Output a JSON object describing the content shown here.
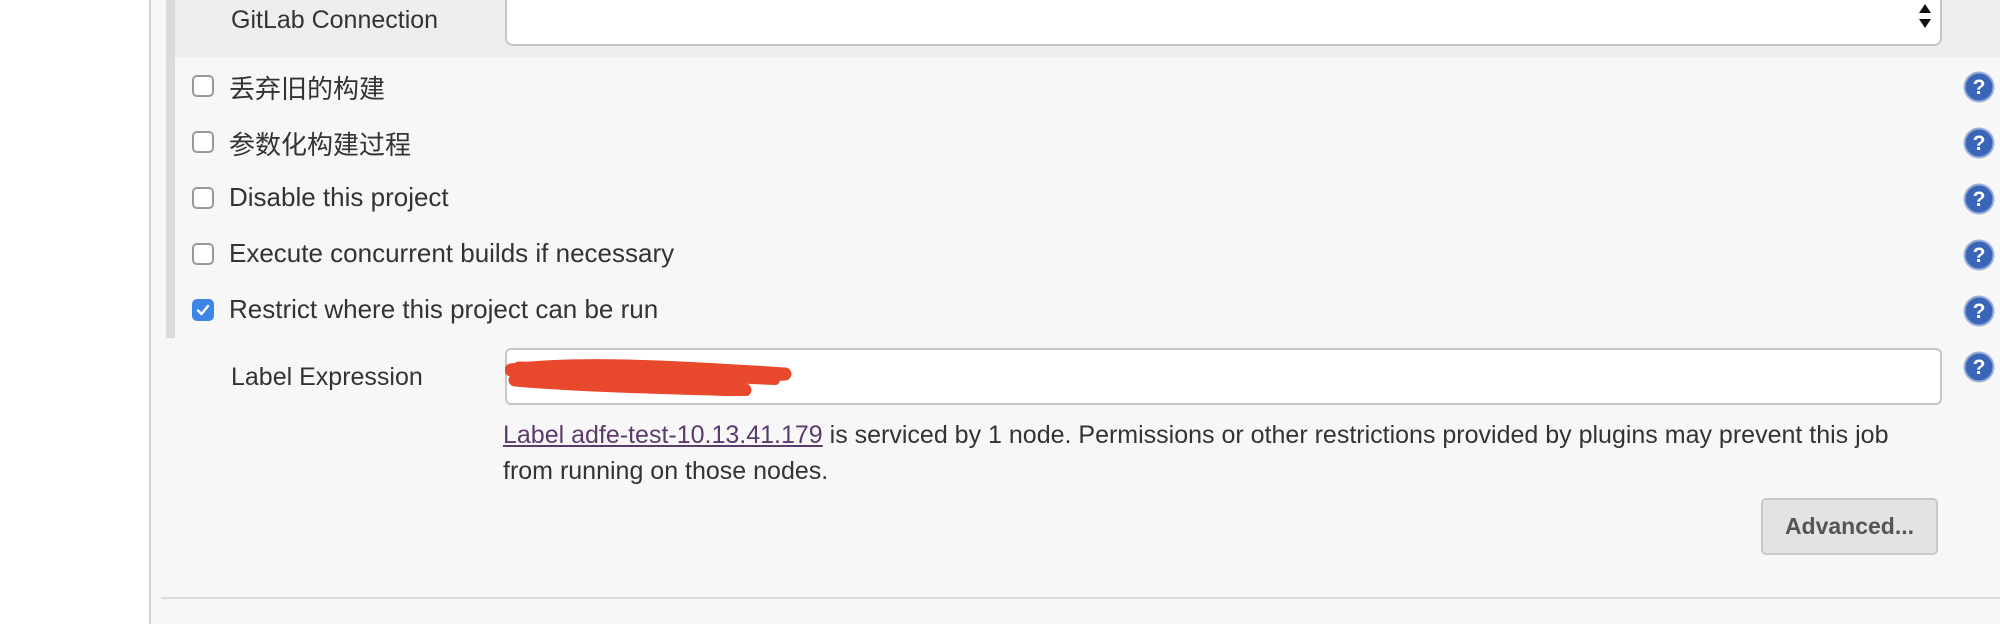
{
  "gitlab": {
    "label": "GitLab Connection",
    "selected": ""
  },
  "options": [
    {
      "label": "丢弃旧的构建",
      "checked": false
    },
    {
      "label": "参数化构建过程",
      "checked": false
    },
    {
      "label": "Disable this project",
      "checked": false
    },
    {
      "label": "Execute concurrent builds if necessary",
      "checked": false
    },
    {
      "label": "Restrict where this project can be run",
      "checked": true
    }
  ],
  "label_expression": {
    "label": "Label Expression",
    "value": "adfe-test-10.13.41.179",
    "info_link": "Label adfe-test-10.13.41.179",
    "info_text": " is serviced by 1 node. Permissions or other restrictions provided by plugins may prevent this job from running on those nodes."
  },
  "advanced_button": "Advanced...",
  "colors": {
    "checkbox_checked": "#3d85e6",
    "help_icon": "#3a66b8",
    "link": "#5b3b6c",
    "redaction": "#e8482c"
  }
}
